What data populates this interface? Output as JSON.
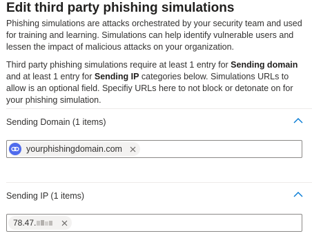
{
  "page": {
    "title": "Edit third party phishing simulations",
    "description": "Phishing simulations are attacks orchestrated by your security team and used for training and learning. Simulations can help identify vulnerable users and lessen the impact of malicious attacks on your organization.",
    "requirement": {
      "part1": "Third party phishing simulations require at least 1 entry for ",
      "bold1": "Sending domain",
      "part2": " and at least 1 entry for ",
      "bold2": "Sending IP",
      "part3": " categories below. Simulations URLs to allow is an optional field. Specifiy URLs here to not block or detonate on for your phishing simulation."
    }
  },
  "sections": {
    "sending_domain": {
      "label": "Sending Domain (1 items)",
      "chevron_icon": "chevron-up-icon",
      "entries": [
        {
          "icon": "link-icon",
          "value": "yourphishingdomain.com",
          "remove_icon": "close-icon"
        }
      ]
    },
    "sending_ip": {
      "label": "Sending IP (1 items)",
      "chevron_icon": "chevron-up-icon",
      "entries": [
        {
          "value": "78.47.",
          "masked": true,
          "remove_icon": "close-icon"
        }
      ]
    }
  },
  "colors": {
    "accent": "#0078d4",
    "pill_icon": "#4f6bed",
    "pill_bg": "#f3f2f1",
    "border": "#8a8886"
  }
}
